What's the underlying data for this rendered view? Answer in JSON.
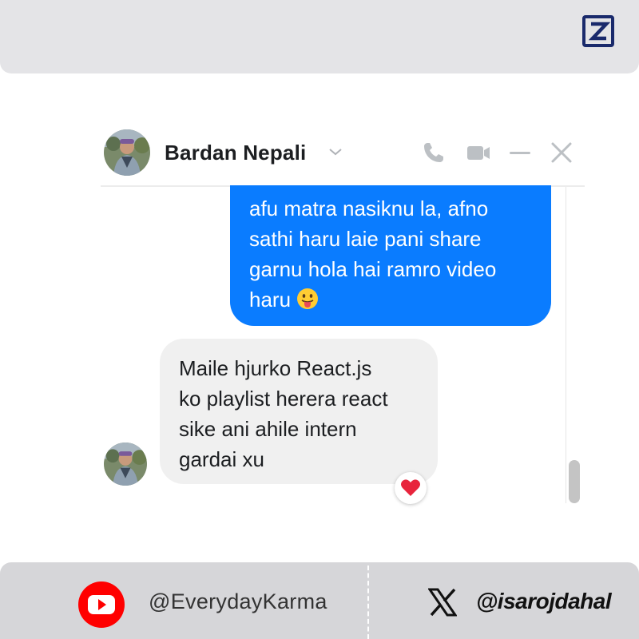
{
  "brand": {
    "logo_icon": "z-logo-icon",
    "color": "#1a2a6c"
  },
  "chat": {
    "contact_name": "Bardan Nepali",
    "header_icons": [
      "phone-icon",
      "video-call-icon",
      "minimize-icon",
      "close-icon"
    ],
    "outgoing": {
      "lines": [
        "afu matra nasiknu la, afno",
        "sathi haru laie pani share",
        "garnu hola hai ramro video",
        "haru"
      ],
      "emoji": "tongue-out-emoji",
      "color": "#0a7cff"
    },
    "incoming": {
      "lines": [
        "Maile hjurko React.js",
        "ko playlist herera react",
        "sike ani ahile intern",
        "gardai xu"
      ],
      "reaction": "heart-reaction-icon",
      "color": "#f0f0f0"
    }
  },
  "footer": {
    "youtube": {
      "icon": "youtube-icon",
      "handle": "@EverydayKarma",
      "color": "#ff0000"
    },
    "x": {
      "icon": "x-logo-icon",
      "handle": "@isarojdahal"
    }
  }
}
